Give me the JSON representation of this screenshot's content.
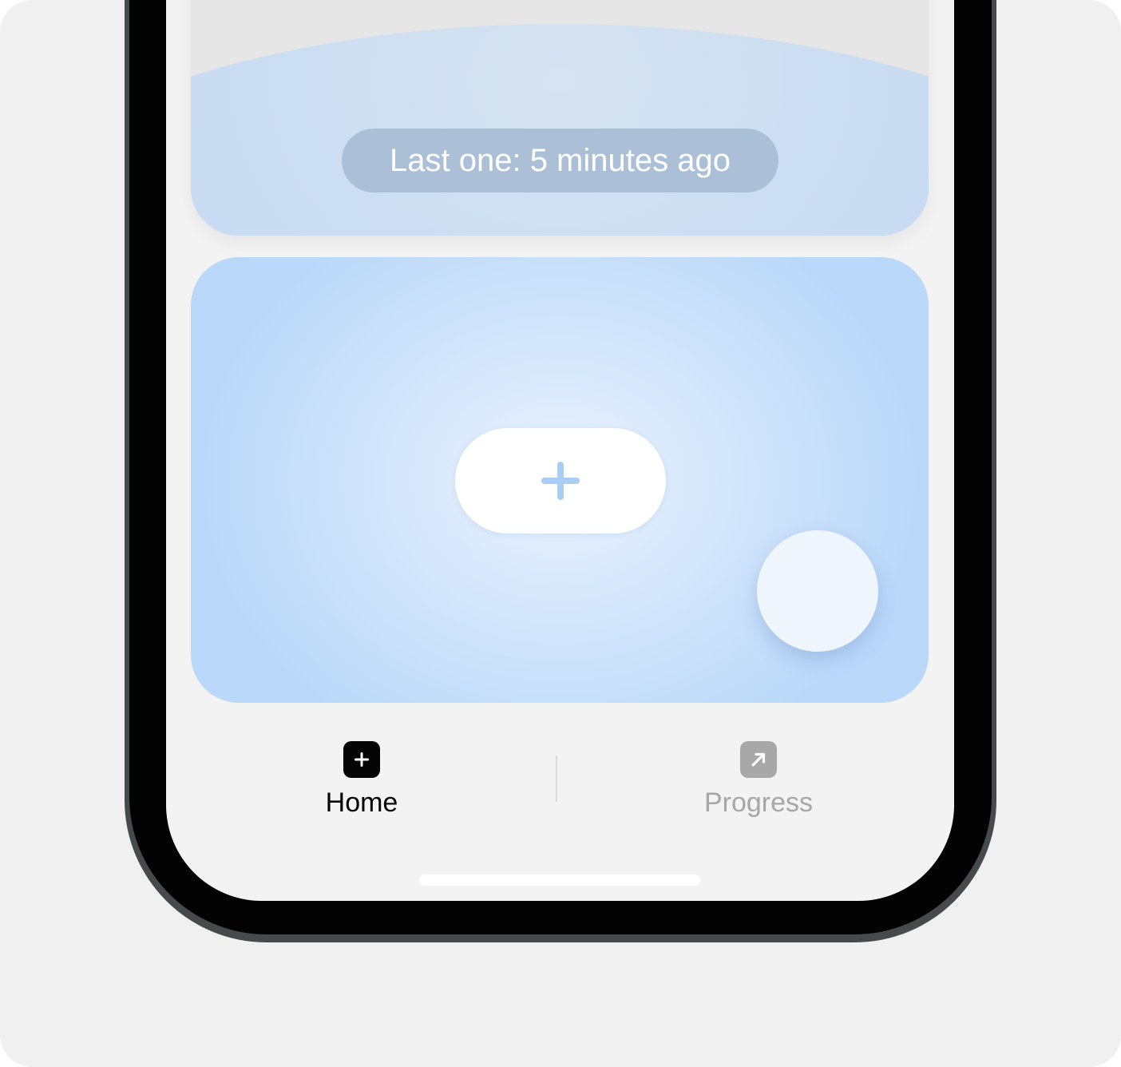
{
  "top_card": {
    "last_entry_label": "Last one: 5 minutes ago"
  },
  "main_card": {
    "add_button_icon": "plus-icon",
    "floating_button_icon": "blank-circle"
  },
  "tab_bar": {
    "tabs": [
      {
        "label": "Home",
        "icon": "plus-square-icon",
        "active": true
      },
      {
        "label": "Progress",
        "icon": "arrow-up-right-square-icon",
        "active": false
      }
    ]
  },
  "colors": {
    "accent": "#a9cdf4",
    "active_tab": "#050505",
    "inactive_tab": "#a7a7a7",
    "card_background": "#b9d8fa"
  }
}
